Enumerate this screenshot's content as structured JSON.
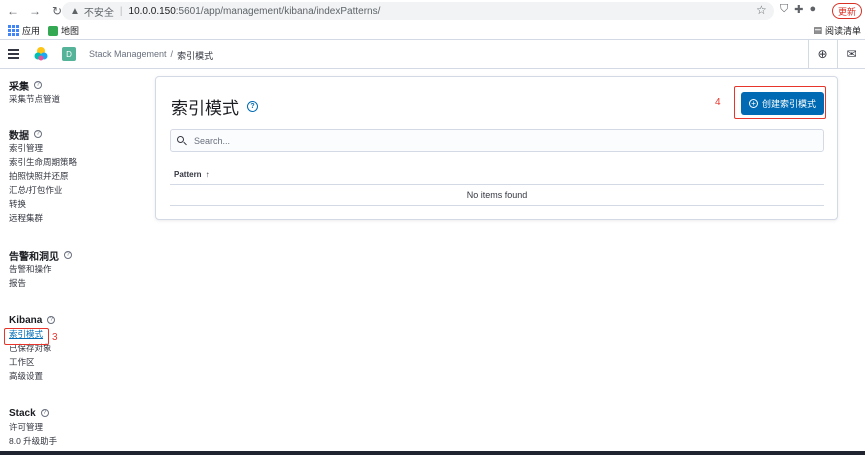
{
  "browser": {
    "url_warning": "▲",
    "url_insecure": "不安全",
    "url_sep": "|",
    "url_host": "10.0.0.150",
    "url_path": ":5601/app/management/kibana/indexPatterns/",
    "update_label": "更新",
    "bookmarks": [
      "应用",
      "地图"
    ],
    "reader_label": "阅读清单"
  },
  "header": {
    "space_initial": "D",
    "breadcrumbs": [
      "Stack Management",
      "/",
      "索引模式"
    ]
  },
  "sidebar": {
    "groups": [
      {
        "title": "采集",
        "items": [
          "采集节点管道"
        ]
      },
      {
        "title": "数据",
        "items": [
          "索引管理",
          "索引生命周期策略",
          "拍照快照并还原",
          "汇总/打包作业",
          "转换",
          "远程集群"
        ]
      },
      {
        "title": "告警和洞见",
        "items": [
          "告警和操作",
          "报告"
        ]
      },
      {
        "title": "Kibana",
        "items": [
          "索引模式",
          "已保存对象",
          "工作区",
          "高级设置"
        ]
      },
      {
        "title": "Stack",
        "items": [
          "许可管理",
          "8.0 升级助手"
        ]
      }
    ]
  },
  "annotations": {
    "step3": "3",
    "step4": "4"
  },
  "main": {
    "title": "索引模式",
    "create_button": "创建索引模式",
    "search_placeholder": "Search...",
    "column_pattern": "Pattern",
    "sort_arrow": "↑",
    "empty_message": "No items found"
  },
  "colors": {
    "primary": "#006bb4",
    "annotation": "#e7352b",
    "space_avatar": "#54b399"
  }
}
